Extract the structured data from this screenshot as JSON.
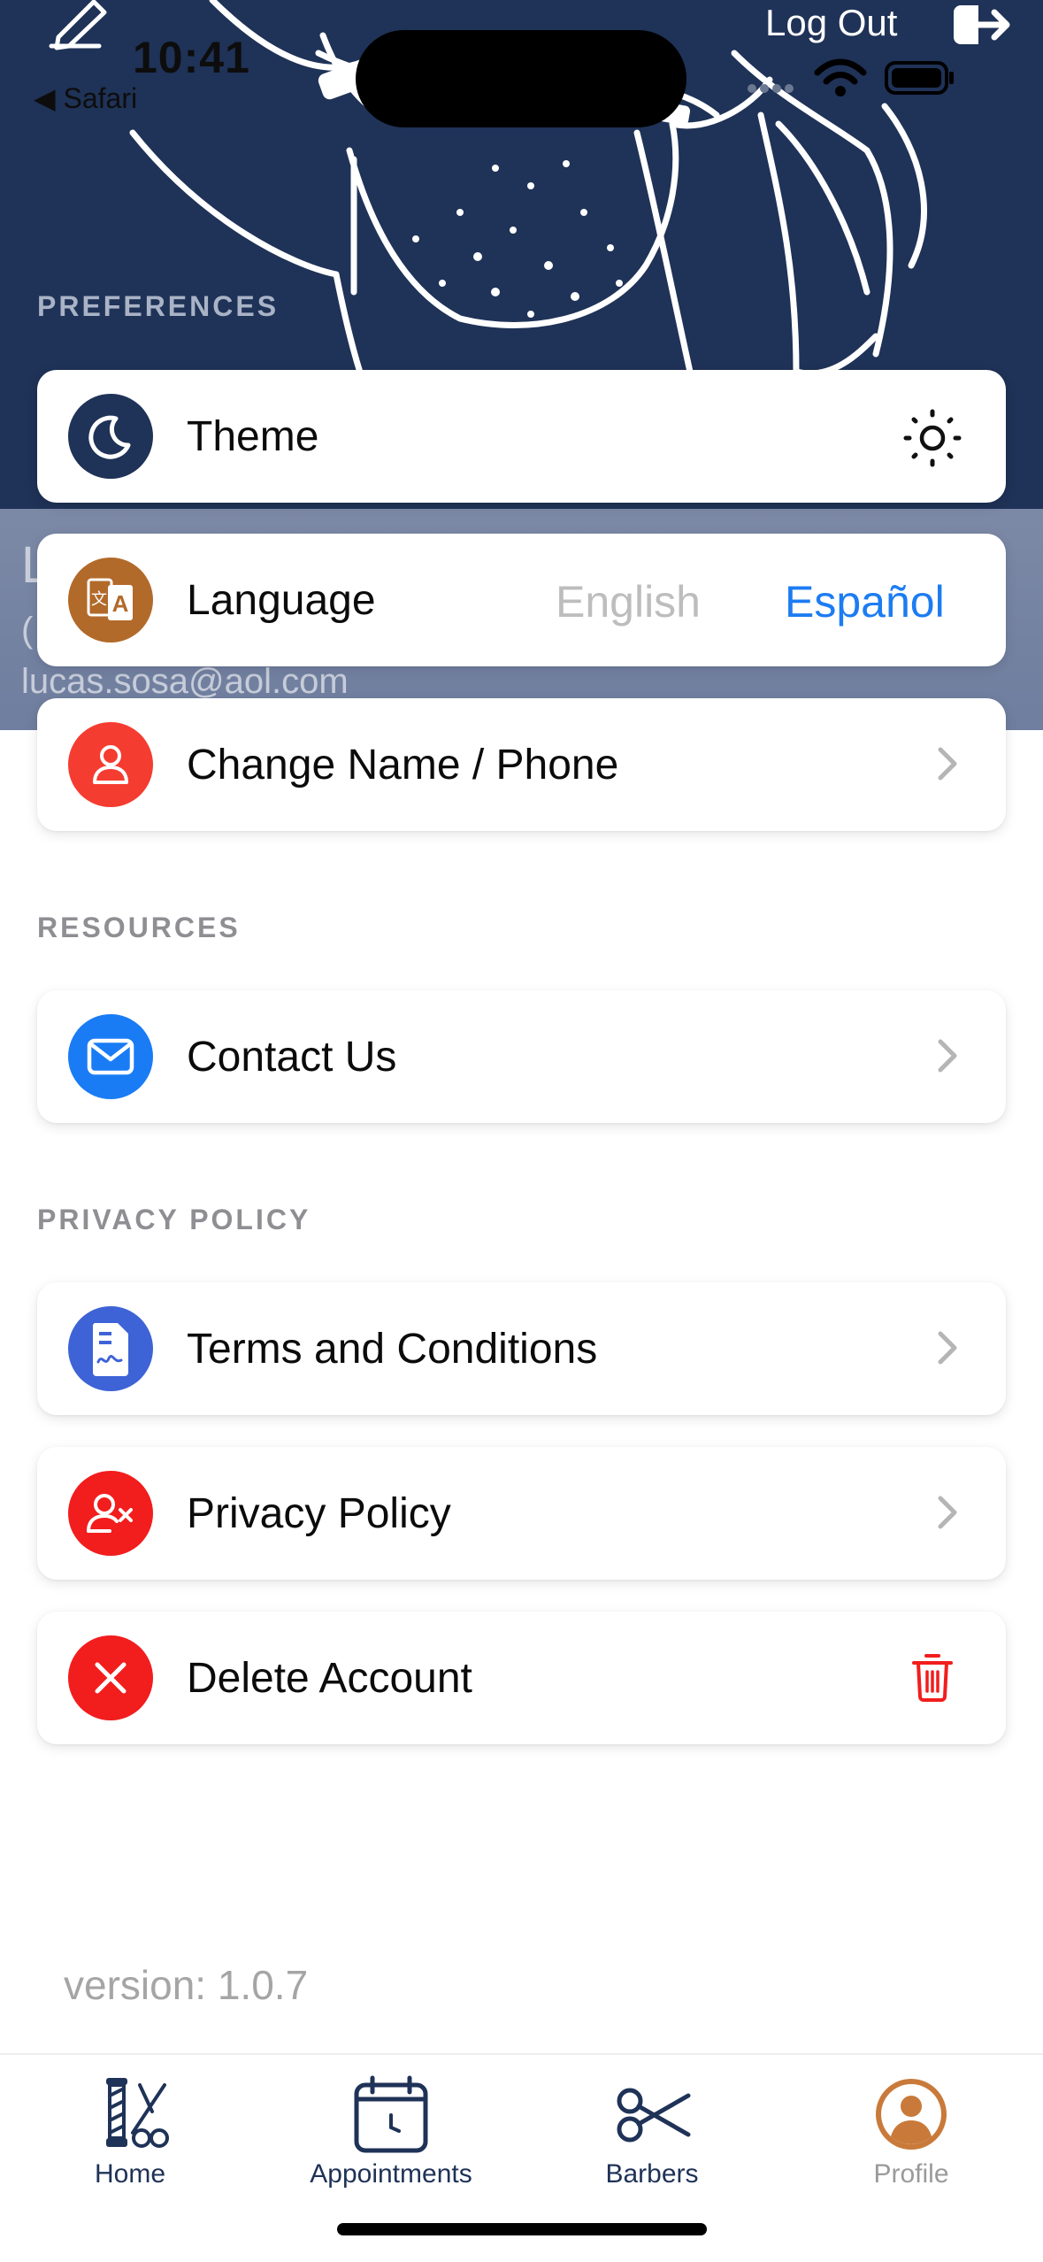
{
  "status_bar": {
    "time": "10:41",
    "back_app": "◀ Safari"
  },
  "header": {
    "logout_label": "Log Out"
  },
  "profile": {
    "initial": "L",
    "phone_partial": "(",
    "email": "lucas.sosa@aol.com"
  },
  "sections": {
    "preferences": "PREFERENCES",
    "resources": "RESOURCES",
    "privacy": "PRIVACY POLICY"
  },
  "rows": {
    "theme": "Theme",
    "language": "Language",
    "language_option_english": "English",
    "language_option_spanish": "Español",
    "change_name": "Change Name / Phone",
    "contact": "Contact Us",
    "terms": "Terms and Conditions",
    "privacy": "Privacy Policy",
    "delete": "Delete Account"
  },
  "version": "version: 1.0.7",
  "tabs": [
    {
      "label": "Home"
    },
    {
      "label": "Appointments"
    },
    {
      "label": "Barbers"
    },
    {
      "label": "Profile"
    }
  ],
  "colors": {
    "brand_navy": "#1f3257",
    "accent_blue": "#1c7cf2",
    "danger_red": "#f21d1d",
    "language_icon_bg": "#b26a2a",
    "terms_icon_bg": "#3e63d6",
    "contact_icon_bg": "#1a7cf5",
    "profile_icon": "#c97a3a"
  },
  "icons": {
    "theme": "moon-icon",
    "theme_toggle": "sun-icon",
    "language": "translate-icon",
    "change_name": "person-icon",
    "contact": "envelope-icon",
    "terms": "document-icon",
    "privacy": "user-x-icon",
    "delete": "x-icon",
    "delete_action": "trash-icon"
  }
}
